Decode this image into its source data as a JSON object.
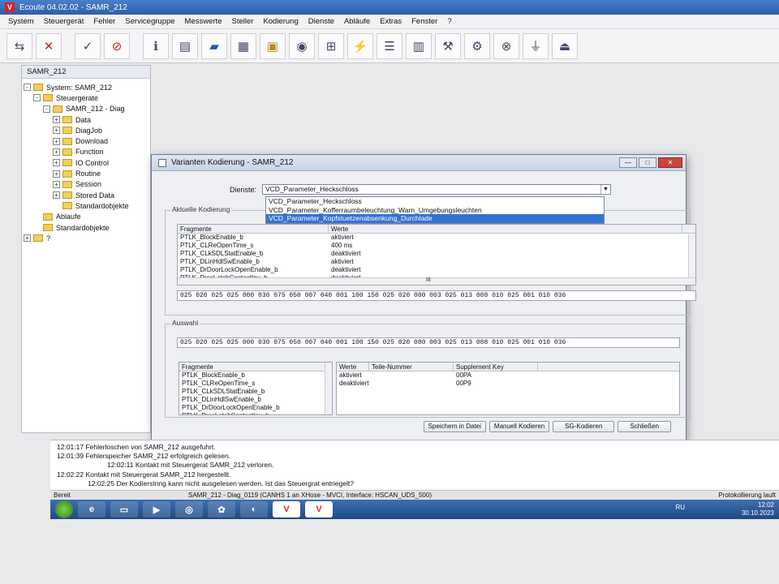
{
  "app": {
    "title": "Ecoute 04.02.02 - SAMR_212",
    "logo": "V"
  },
  "menu": [
    "System",
    "Steuergerät",
    "Fehler",
    "Servicegruppe",
    "Messwerte",
    "Steller",
    "Kodierung",
    "Dienste",
    "Abläufe",
    "Extras",
    "Fenster",
    "?"
  ],
  "toolbar": {
    "icons": [
      "connect-icon",
      "disconnect-icon",
      "check-icon",
      "cancel-check-icon",
      "info-icon",
      "report-icon",
      "car-icon",
      "measure-icon",
      "open-folder-icon",
      "eye-icon",
      "network-icon",
      "flash-icon",
      "list-icon",
      "table-icon",
      "tools-icon",
      "settings-icon",
      "binoculars-icon",
      "plug-icon",
      "unplug-icon"
    ]
  },
  "tree": {
    "header": "SAMR_212",
    "nodes": [
      {
        "label": "System: SAMR_212",
        "level": 0,
        "expander": "-"
      },
      {
        "label": "Steuergerate",
        "level": 1,
        "expander": "-"
      },
      {
        "label": "SAMR_212 - Diag",
        "level": 2,
        "expander": "-"
      },
      {
        "label": "Data",
        "level": 3,
        "expander": "+"
      },
      {
        "label": "DiagJob",
        "level": 3,
        "expander": "+"
      },
      {
        "label": "Download",
        "level": 3,
        "expander": "+"
      },
      {
        "label": "Function",
        "level": 3,
        "expander": "+"
      },
      {
        "label": "IO Control",
        "level": 3,
        "expander": "+"
      },
      {
        "label": "Routine",
        "level": 3,
        "expander": "+"
      },
      {
        "label": "Session",
        "level": 3,
        "expander": "+"
      },
      {
        "label": "Stored Data",
        "level": 3,
        "expander": "+"
      },
      {
        "label": "Standardobjekte",
        "level": 3,
        "expander": ""
      },
      {
        "label": "Ablaufe",
        "level": 1,
        "expander": ""
      },
      {
        "label": "Standardobjekte",
        "level": 1,
        "expander": ""
      },
      {
        "label": "?",
        "level": 0,
        "expander": "+"
      }
    ]
  },
  "dialog": {
    "title": "Varianten Kodierung - SAMR_212",
    "dienste_label": "Dienste:",
    "dienste_value": "VCD_Parameter_Heckschloss",
    "dropdown_options": [
      "VCD_Parameter_Heckschloss",
      "VCD_Parameter_Kofferraumbeleuchtung_Warn_Umgebungsleuchten",
      "VCD_Parameter_Kopfstuetzenabsenkung_Durchlade"
    ],
    "dropdown_selected_index": 2,
    "aktuelle": {
      "label": "Aktuelle Kodierung",
      "columns": [
        "Fragmente",
        "Werte"
      ],
      "rows": [
        [
          "PTLK_BlockEnable_b",
          "aktiviert"
        ],
        [
          "PTLK_CLReOpenTime_s",
          "400 ms"
        ],
        [
          "PTLK_CLkSDLStatEnable_b",
          "deaktiviert"
        ],
        [
          "PTLK_DLinHdlSwEnable_b",
          "aktiviert"
        ],
        [
          "PTLK_DrDoorLockOpenEnable_b",
          "deaktiviert"
        ],
        [
          "PTLK_PrecLatchContactInv_b",
          "deaktiviert"
        ]
      ],
      "scroll_mark": "III",
      "code": "025 020 025 025 000 030 075 050 007 040 001 100 150 025 020 080 003 025 013 008 010 025 001 010 036"
    },
    "auswahl": {
      "label": "Auswahl",
      "code": "025 020 025 025 000 030 075 050 007 040 001 100 150 025 020 080 003 025 013 008 010 025 001 010 036",
      "fragment_header": "Fragmente",
      "fragments": [
        "PTLK_BlockEnable_b",
        "PTLK_CLReOpenTime_s",
        "PTLK_CLkSDLStatEnable_b",
        "PTLK_DLinHdlSwEnable_b",
        "PTLK_DrDoorLockOpenEnable_b",
        "PTLK_PrecLatchContactInv_b"
      ],
      "value_columns": [
        "Werte",
        "Teile-Nummer",
        "Supplement Key"
      ],
      "values": [
        [
          "aktiviert",
          "",
          "00PA"
        ],
        [
          "deaktiviert",
          "",
          "00P9"
        ]
      ]
    },
    "buttons": [
      "Speichern in Datei",
      "Manuell Kodieren",
      "SG-Kodieren",
      "Schließen"
    ]
  },
  "log": [
    "12:01:17 Fehlerloschen von SAMR_212 ausgefuhrt.",
    "12:01:39 Fehlerspeicher SAMR_212 erfolgreich gelesen.",
    "12:02:11 Kontakt mit Steuergerat SAMR_212 verloren.",
    "12:02:22 Kontakt mit Steuergerat SAMR_212 hergestellt.",
    "12:02:25 Der Kodierstring kann nicht ausgelesen werden. Ist das Steuergrat entriegelt?"
  ],
  "status": {
    "left": "Bereit",
    "center": "SAMR_212 - Diag_0119 (CANHS 1 an XHose - MVCI, Interface: HSCAN_UDS_500)",
    "right": "Protokollierung lauft"
  },
  "taskbar": {
    "apps": [
      "start-orb-icon",
      "ie-icon",
      "explorer-icon",
      "media-icon",
      "chrome-icon",
      "app-icon",
      "firefox-icon",
      "vcds-icon",
      "vcds-icon-2"
    ],
    "lang": "RU",
    "time": "12:02",
    "date": "30.10.2023"
  }
}
